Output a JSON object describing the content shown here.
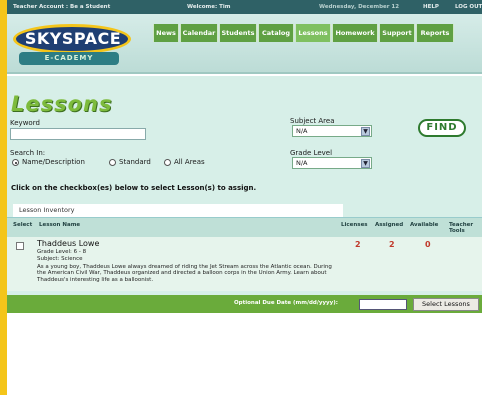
{
  "topbar": {
    "account": "Teacher Account : Be a Student",
    "welcome": "Welcome: Tim",
    "date": "Wednesday, December 12",
    "help": "HELP",
    "logout": "LOG OUT"
  },
  "logo": {
    "brand": "SKYSPACE",
    "sub": "E-CADEMY"
  },
  "nav": [
    "News",
    "Calendar",
    "Students",
    "Catalog",
    "Lessons",
    "Homework",
    "Support",
    "Reports"
  ],
  "page_title": "Lessons",
  "search": {
    "keyword_label": "Keyword",
    "keyword_value": "",
    "subject_label": "Subject Area",
    "subject_value": "N/A",
    "search_in_label": "Search In:",
    "options": [
      "Name/Description",
      "Standard",
      "All Areas"
    ],
    "grade_label": "Grade Level",
    "grade_value": "N/A",
    "find_label": "FIND"
  },
  "instruction": "Click on the checkbox(es) below to select Lesson(s) to assign.",
  "inventory_tab": "Lesson Inventory",
  "table": {
    "headers": {
      "select": "Select",
      "name": "Lesson Name",
      "licenses": "Licenses",
      "assigned": "Assigned",
      "available": "Available",
      "teacher_tools": "Teacher Tools"
    },
    "rows": [
      {
        "name": "Thaddeus Lowe",
        "grade": "Grade Level: 6 - 8",
        "subject": "Subject: Science",
        "description": "As a young boy, Thaddeus Lowe always dreamed of riding the Jet Stream across the Atlantic ocean. During the American Civil War, Thaddeus organized and directed a balloon corps in the Union Army. Learn about Thaddeus's interesting life as a balloonist.",
        "licenses": "2",
        "assigned": "2",
        "available": "0"
      }
    ]
  },
  "due": {
    "label": "Optional Due Date (mm/dd/yyyy):",
    "value": "",
    "button": "Select Lessons"
  },
  "colors": {
    "frame": "#f4c51a",
    "topbar": "#2f6166",
    "nav": "#5fa043",
    "content": "#d7efe8",
    "accent_green": "#6aab3b",
    "number_red": "#c0392b"
  }
}
